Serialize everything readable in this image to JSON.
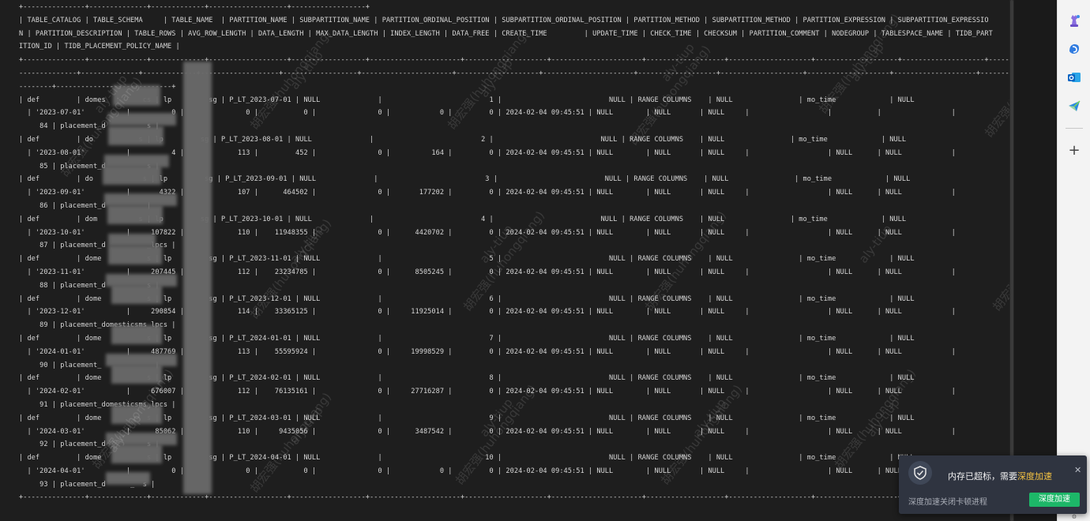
{
  "terminal": {
    "lines": [
      "+---------------+--------------+-------------+-------------------+------------------+",
      "| TABLE_CATALOG | TABLE_SCHEMA     | TABLE_NAME  | PARTITION_NAME | SUBPARTITION_NAME | PARTITION_ORDINAL_POSITION | SUBPARTITION_ORDINAL_POSITION | PARTITION_METHOD | SUBPARTITION_METHOD | PARTITION_EXPRESSION | SUBPARTITION_EXPRESSIO",
      "N | PARTITION_DESCRIPTION | TABLE_ROWS | AVG_ROW_LENGTH | DATA_LENGTH | MAX_DATA_LENGTH | INDEX_LENGTH | DATA_FREE | CREATE_TIME         | UPDATE_TIME | CHECK_TIME | CHECKSUM | PARTITION_COMMENT | NODEGROUP | TABLESPACE_NAME | TIDB_PART",
      "ITION_ID | TIDB_PLACEMENT_POLICY_NAME |",
      "+---------------+--------------+-------------+-------------------+------------------+----------------------+--------------------+----------------------+-------------------+--------------------+--------------------+--------------------+--------------------------------------",
      "--------------+--------------+-------------+-------------------+------------------+----------------------+--------------------+----------------------+-------------------+--------------------+--------------------+--------------------+--------------------------------------",
      "--------+----------------------------+",
      "| def         | domes         cs | lp         sg | P_LT_2023-07-01 | NULL              |                          1 |                          NULL | RANGE COLUMNS    | NULL                | mo_time             | NULL",
      "  | '2023-07-01'          |          0 |               0 |           0 |               0 |            0 |         0 | 2024-02-04 09:45:51 | NULL        | NULL       | NULL     |                   |           |                 |",
      "     84 | placement_d          s |",
      "| def         | do           s | lp         sg | P_LT_2023-08-01 | NULL              |                          2 |                          NULL | RANGE COLUMNS    | NULL                | mo_time             | NULL",
      "  | '2023-08-01'          |          4 |             113 |         452 |               0 |          164 |         0 | 2024-02-04 09:45:51 | NULL        | NULL       | NULL     |                   | NULL      | NULL            |",
      "     85 | placement_d          s |",
      "| def         | do            s | lp         sg | P_LT_2023-09-01 | NULL              |                          3 |                          NULL | RANGE COLUMNS    | NULL                | mo_time             | NULL",
      "  | '2023-09-01'          |       4322 |             107 |      464502 |               0 |       177202 |         0 | 2024-02-04 09:45:51 | NULL        | NULL       | NULL     |                   | NULL      | NULL            |",
      "     86 | placement_d          |",
      "| def         | dom          s | lp         sg | P_LT_2023-10-01 | NULL              |                          4 |                          NULL | RANGE COLUMNS    | NULL                | mo_time             | NULL",
      "  | '2023-10-01'          |     107822 |             110 |    11948355 |               0 |      4420702 |         0 | 2024-02-04 09:45:51 | NULL        | NULL       | NULL     |                   | NULL      | NULL            |",
      "     87 | placement_d          _lpcs |",
      "| def         | dome           s | lp         sg | P_LT_2023-11-01 | NULL              |                          5 |                          NULL | RANGE COLUMNS    | NULL                | mo_time             | NULL",
      "  | '2023-11-01'          |     207445 |             112 |    23234785 |               0 |      8505245 |         0 | 2024-02-04 09:45:51 | NULL        | NULL       | NULL     |                   | NULL      | NULL            |",
      "     88 | placement_d          s |",
      "| def         | dome           s | lp         sg | P_LT_2023-12-01 | NULL              |                          6 |                          NULL | RANGE COLUMNS    | NULL                | mo_time             | NULL",
      "  | '2023-12-01'          |     290854 |             114 |    33365125 |               0 |     11925014 |         0 | 2024-02-04 09:45:51 | NULL        | NULL       | NULL     |                   | NULL      | NULL            |",
      "     89 | placement_domesticsms_lpcs |",
      "| def         | dome           s | lp         sg | P_LT_2024-01-01 | NULL              |                          7 |                          NULL | RANGE COLUMNS    | NULL                | mo_time             | NULL",
      "  | '2024-01-01'          |     487769 |             113 |    55595924 |               0 |     19998529 |         0 | 2024-02-04 09:45:51 | NULL        | NULL       | NULL     |                   | NULL      | NULL            |",
      "     90 | placement_             |",
      "| def         | dome           s | lp         sg | P_LT_2024-02-01 | NULL              |                          8 |                          NULL | RANGE COLUMNS    | NULL                | mo_time             | NULL",
      "  | '2024-02-01'          |     676007 |             112 |    76135161 |               0 |     27716287 |         0 | 2024-02-04 09:45:51 | NULL        | NULL       | NULL     |                   | NULL      | NULL            |",
      "     91 | placement_domesticsms_lpcs |",
      "| def         | dome           s | lp         sg | P_LT_2024-03-01 | NULL              |                          9 |                          NULL | RANGE COLUMNS    | NULL                | mo_time             | NULL",
      "  | '2024-03-01'          |      85062 |             110 |     9435056 |               0 |      3487542 |         0 | 2024-02-04 09:45:51 | NULL        | NULL       | NULL     |                   | NULL      | NULL            |",
      "     92 | placement_d          s |",
      "| def         | dome           s | lp         sg | P_LT_2024-04-01 | NULL              |                         10 |                          NULL | RANGE COLUMNS    | NULL                | mo_time             | NULL",
      "  | '2024-04-01'          |          0 |               0 |           0 |               0 |            0 |         0 | 2024-02-04 09:45:51 | NULL        | NULL       | NULL     |                   | NULL      | NULL            |",
      "     93 | placement_d      _  s |",
      "+---------------+--------------+-------------+-------------------+------------------+----------------------+--------------------+----------------------+-------------------+--------------------+--------------------+--------------------+--------------------------------------",
      "",
      "--------+----------------------------+"
    ]
  },
  "watermark": {
    "name": "胡宏强(huhongqiang)",
    "id": "aly-tiup"
  },
  "sidebar": {
    "icons": [
      "chess-piece-icon",
      "copilot-icon",
      "outlook-icon",
      "send-icon"
    ],
    "add_label": "+"
  },
  "toast": {
    "message_prefix": "内存已超标，需要",
    "message_link": "深度加速",
    "close": "✕",
    "subtitle": "深度加速关闭卡顿进程",
    "button_label": "深度加速"
  },
  "colors": {
    "terminal_bg": "#1e1e1e",
    "terminal_text": "#d6d6d6",
    "toast_bg": "#2f3440",
    "toast_button": "#1db768",
    "toast_highlight": "#f5c342"
  }
}
